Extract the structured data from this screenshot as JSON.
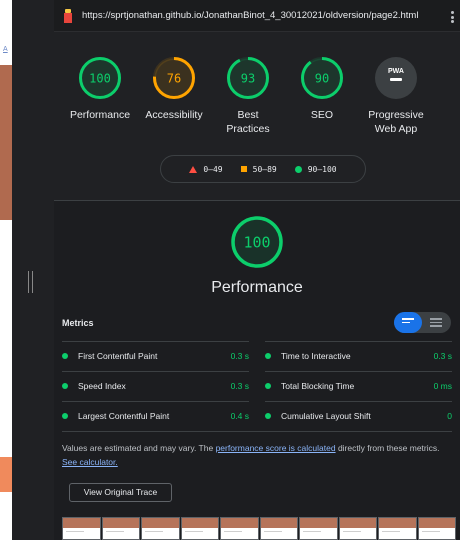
{
  "browser": {
    "url": "https://sprtjonathan.github.io/JonathanBinot_4_30012021/oldversion/page2.html",
    "left_link": "A"
  },
  "colors": {
    "pass": "#0cce6b",
    "average": "#ffa400",
    "fail": "#ff4e42",
    "accent": "#1a73e8"
  },
  "categories": [
    {
      "score": "100",
      "label": "Performance",
      "status": "pass",
      "fraction": 1.0
    },
    {
      "score": "76",
      "label": "Accessibility",
      "status": "average",
      "fraction": 0.76
    },
    {
      "score": "93",
      "label": "Best Practices",
      "status": "pass",
      "fraction": 0.93
    },
    {
      "score": "90",
      "label": "SEO",
      "status": "pass",
      "fraction": 0.9
    },
    {
      "score": "PWA",
      "label": "Progressive Web App",
      "status": "pwa"
    }
  ],
  "legend": {
    "fail": "0–49",
    "average": "50–89",
    "pass": "90–100"
  },
  "performance": {
    "score": "100",
    "title": "Performance",
    "metrics_heading": "Metrics",
    "metrics": [
      {
        "name": "First Contentful Paint",
        "value": "0.3 s"
      },
      {
        "name": "Time to Interactive",
        "value": "0.3 s"
      },
      {
        "name": "Speed Index",
        "value": "0.3 s"
      },
      {
        "name": "Total Blocking Time",
        "value": "0 ms"
      },
      {
        "name": "Largest Contentful Paint",
        "value": "0.4 s"
      },
      {
        "name": "Cumulative Layout Shift",
        "value": "0"
      }
    ],
    "note_prefix": "Values are estimated and may vary. The ",
    "note_link": "performance score is calculated",
    "note_middle": " directly from these metrics. ",
    "note_link2": "See calculator.",
    "trace_button": "View Original Trace"
  }
}
